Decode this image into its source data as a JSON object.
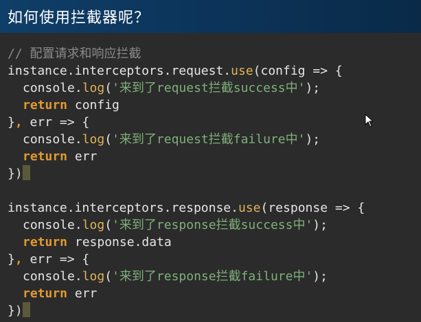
{
  "header": {
    "title": "如何使用拦截器呢？"
  },
  "code": {
    "comment": "// 配置请求和响应拦截",
    "obj": "instance",
    "interceptors": "interceptors",
    "request": "request",
    "response": "response",
    "use": "use",
    "config": "config",
    "err": "err",
    "console": "console",
    "log": "log",
    "return_kw": "return",
    "arrow": "=>",
    "response_data": "response.data",
    "str_req_success": "'来到了request拦截success中'",
    "str_req_failure": "'来到了request拦截failure中'",
    "str_res_success": "'来到了response拦截success中'",
    "str_res_failure": "'来到了response拦截failure中'"
  }
}
